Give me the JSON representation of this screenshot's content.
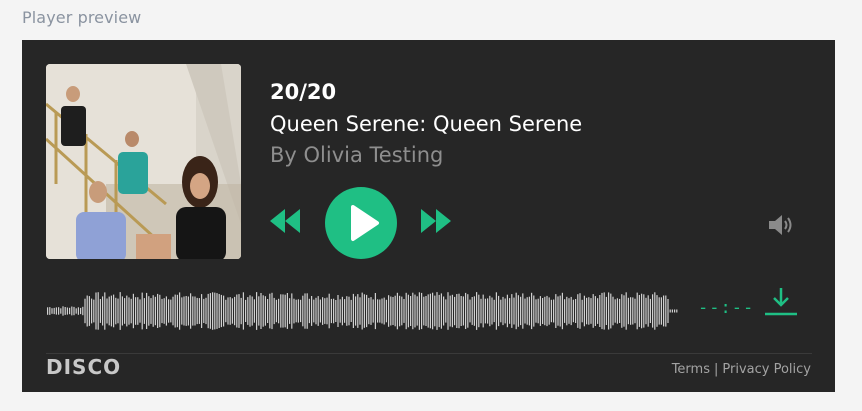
{
  "section": {
    "title": "Player preview"
  },
  "track": {
    "number": "20/20",
    "title": "Queen Serene: Queen Serene",
    "artist": "By Olivia Testing"
  },
  "controls": {
    "rewind_icon": "rewind-icon",
    "play_icon": "play-icon",
    "forward_icon": "fast-forward-icon",
    "volume_icon": "volume-icon",
    "download_icon": "download-icon"
  },
  "time": {
    "display": "--:--"
  },
  "footer": {
    "logo": "DISCO",
    "terms": "Terms",
    "separator": "|",
    "privacy": "Privacy Policy"
  },
  "colors": {
    "accent": "#1fbf84",
    "player_bg": "#262626",
    "page_bg": "#f4f4f4"
  }
}
